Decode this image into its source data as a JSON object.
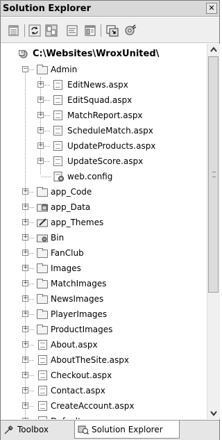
{
  "panel": {
    "title": "Solution Explorer",
    "close_glyph": "✕"
  },
  "toolbar": {
    "buttons": [
      {
        "name": "properties-icon"
      },
      {
        "name": "refresh-icon"
      },
      {
        "name": "nest-related-files-icon"
      },
      {
        "name": "view-code-icon"
      },
      {
        "name": "view-designer-icon"
      },
      {
        "name": "copy-web-site-icon"
      },
      {
        "name": "asp-net-configuration-icon"
      }
    ]
  },
  "tree": {
    "root": "C:\\Websites\\WroxUnited\\",
    "admin": {
      "label": "Admin",
      "children": [
        "EditNews.aspx",
        "EditSquad.aspx",
        "MatchReport.aspx",
        "ScheduleMatch.aspx",
        "UpdateProducts.aspx",
        "UpdateScore.aspx",
        "web.config"
      ]
    },
    "items": [
      "app_Code",
      "app_Data",
      "app_Themes",
      "Bin",
      "FanClub",
      "Images",
      "MatchImages",
      "NewsImages",
      "PlayerImages",
      "ProductImages",
      "About.aspx",
      "AboutTheSite.aspx",
      "Checkout.aspx",
      "Contact.aspx",
      "CreateAccount.aspx",
      "Default.aspx"
    ]
  },
  "tabs": [
    {
      "label": "Toolbox",
      "icon": "toolbox-icon"
    },
    {
      "label": "Solution Explorer",
      "icon": "solution-explorer-icon"
    }
  ]
}
